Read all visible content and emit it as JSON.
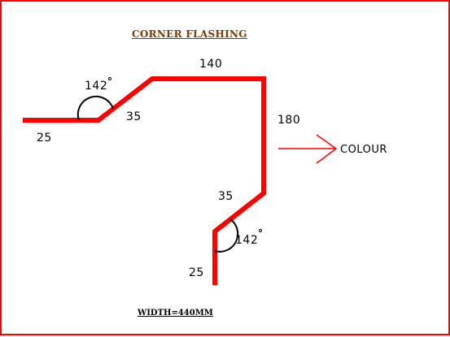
{
  "title": "CORNER FLASHING",
  "footer": "WIDTH=440MM",
  "dimensions": {
    "top_left_flat": "25",
    "upper_slope": "35",
    "top_run": "140",
    "right_drop": "180",
    "lower_slope": "35",
    "bottom_drop": "25"
  },
  "angles": {
    "upper": "142",
    "lower": "142"
  },
  "colour_label": "COLOUR",
  "colors": {
    "profile": "#ff0000",
    "border": "#ff0000",
    "title": "#7a3a00",
    "text": "#000000"
  }
}
